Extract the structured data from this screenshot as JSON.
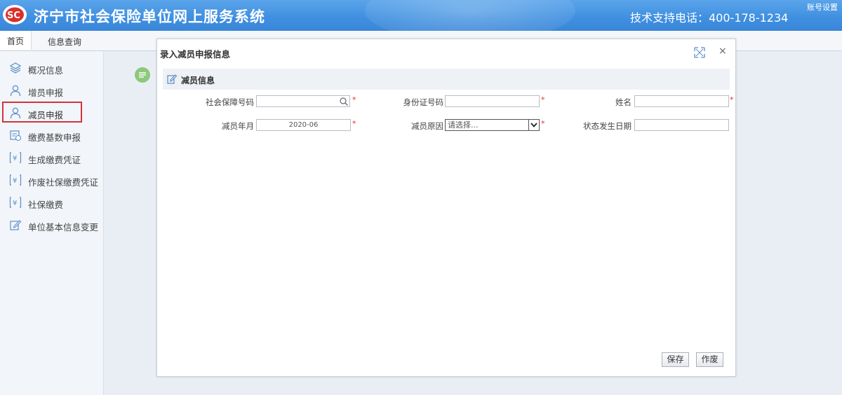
{
  "header": {
    "title": "济宁市社会保险单位网上服务系统",
    "hotline": "技术支持电话：400-178-1234",
    "account": "账号设置"
  },
  "topnav": {
    "tabs": [
      "首页",
      "信息查询"
    ]
  },
  "sidebar": {
    "items": [
      {
        "label": "概况信息",
        "icon": "layers-icon"
      },
      {
        "label": "增员申报",
        "icon": "user-icon"
      },
      {
        "label": "减员申报",
        "icon": "user-icon"
      },
      {
        "label": "缴费基数申报",
        "icon": "report-icon"
      },
      {
        "label": "生成缴费凭证",
        "icon": "yuan-icon"
      },
      {
        "label": "作废社保缴费凭证",
        "icon": "yuan-icon"
      },
      {
        "label": "社保缴费",
        "icon": "yuan-icon"
      },
      {
        "label": "单位基本信息变更",
        "icon": "edit-icon"
      }
    ],
    "selected_index": 2
  },
  "dialog": {
    "title": "录入减员申报信息",
    "section_title": "减员信息",
    "fields": {
      "ssn_label": "社会保障号码",
      "ssn_value": "",
      "id_label": "身份证号码",
      "id_value": "",
      "name_label": "姓名",
      "name_value": "",
      "month_label": "减员年月",
      "month_value": "2020-06",
      "reason_label": "减员原因",
      "reason_value": "请选择...",
      "date_label": "状态发生日期",
      "date_value": ""
    },
    "required_mark": "*",
    "buttons": {
      "save": "保存",
      "void": "作废"
    }
  },
  "colors": {
    "header_blue": "#3f8fe0",
    "selected_outline": "#d3343a",
    "required": "#e03030"
  }
}
